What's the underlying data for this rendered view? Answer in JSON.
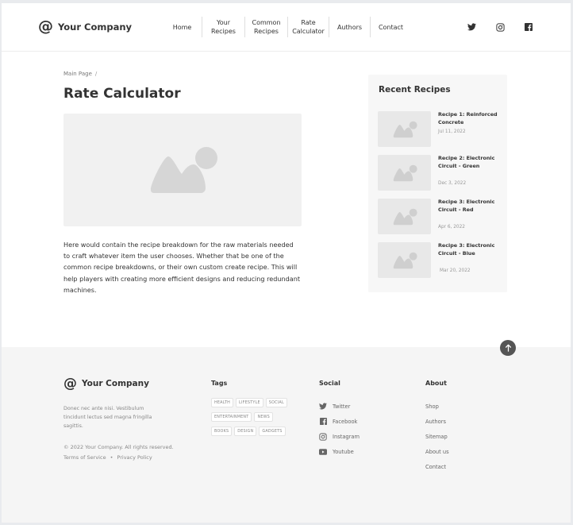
{
  "header": {
    "logo_symbol": "@",
    "logo_name": "Your Company",
    "nav": [
      {
        "label": "Home"
      },
      {
        "label": "Your Recipes"
      },
      {
        "label": "Common\nRecipes"
      },
      {
        "label": "Rate\nCalculator"
      },
      {
        "label": "Authors"
      },
      {
        "label": "Contact"
      }
    ],
    "social_icons": [
      "twitter-icon",
      "instagram-icon",
      "facebook-icon"
    ]
  },
  "main": {
    "breadcrumb": {
      "item": "Main Page",
      "separator": "/"
    },
    "title": "Rate Calculator",
    "description": "Here would contain the recipe breakdown for the raw materials needed to craft whatever item the user chooses. Whether that be one of the common recipe breakdowns, or their own custom create recipe. This will help players with creating more efficient designs and reducing redundant machines."
  },
  "sidebar": {
    "title": "Recent Recipes",
    "recipes": [
      {
        "title": "Recipe 1: Reinforced Concrete",
        "date": "Jul 11, 2022"
      },
      {
        "title": "Recipe 2: Electronic Circuit - Green",
        "date": "Dec 3, 2022"
      },
      {
        "title": "Recipe 3: Electronic Circuit - Red",
        "date": "Apr 6, 2022"
      },
      {
        "title": "Recipe 3: Electronic Circuit - Blue",
        "date": "Mar 20, 2022"
      }
    ]
  },
  "footer": {
    "logo_symbol": "@",
    "logo_name": "Your Company",
    "blurb": "Donec nec ante nisi. Vestibulum tincidunt lectus sed magna fringilla sagittis.",
    "copyright": "© 2022 Your Company.  All rights reserved.",
    "terms": "Terms of Service",
    "legal_separator": "•",
    "privacy": "Privacy Policy",
    "tags_title": "Tags",
    "tags": [
      "HEALTH",
      "LIFESTYLE",
      "SOCIAL",
      "ENTERTAINMENT",
      "NEWS",
      "BOOKS",
      "DESIGN",
      "GADGETS"
    ],
    "social_title": "Social",
    "social": [
      {
        "label": "Twitter",
        "icon": "twitter-icon"
      },
      {
        "label": "Facebook",
        "icon": "facebook-icon"
      },
      {
        "label": "Instagram",
        "icon": "instagram-icon"
      },
      {
        "label": "Youtube",
        "icon": "youtube-icon"
      }
    ],
    "about_title": "About",
    "about": [
      "Shop",
      "Authors",
      "Sitemap",
      "About us",
      "Contact"
    ]
  },
  "colors": {
    "background": "#ffffff",
    "footer_bg": "#f5f5f5",
    "sidebar_bg": "#f7f7f7",
    "placeholder": "#e8e8e8",
    "text": "#333333",
    "muted": "#888888"
  }
}
